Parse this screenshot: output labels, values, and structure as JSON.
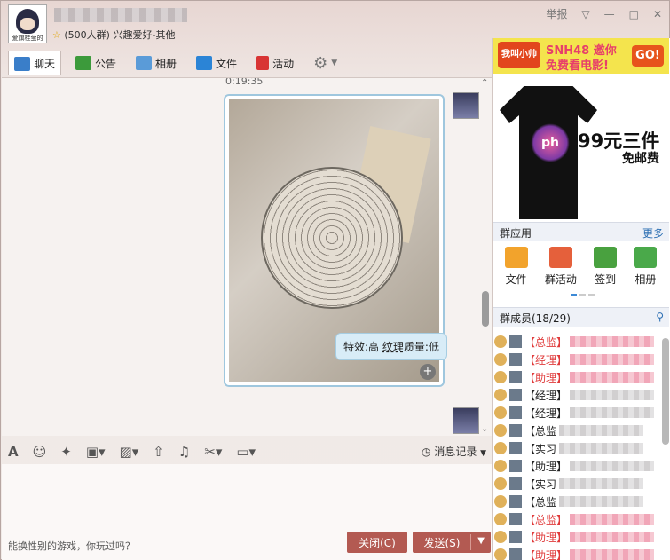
{
  "window": {
    "group_name": "",
    "subtitle_count": "(500人群)",
    "subtitle_category": "兴趣爱好-其他",
    "avatar_caption": "爱旗桂萤的",
    "report_label": "举报",
    "controls": [
      "▽",
      "—",
      "□",
      "✕"
    ]
  },
  "tabs": [
    {
      "label": "聊天",
      "icon": "chat-icon",
      "color": "#3a7ec9"
    },
    {
      "label": "公告",
      "icon": "announcement-flag-icon",
      "color": "#3c9a3b"
    },
    {
      "label": "相册",
      "icon": "photo-album-icon",
      "color": "#5a9bd8"
    },
    {
      "label": "文件",
      "icon": "folder-icon",
      "color": "#2b84d6"
    },
    {
      "label": "活动",
      "icon": "red-flag-icon",
      "color": "#d83434"
    }
  ],
  "chat": {
    "timestamp": "0:19:35",
    "effect_prefix": "特效:高 ",
    "effect_texture": "纹理",
    "effect_suffix": "质量:低"
  },
  "input_toolbar": {
    "history_label": "消息记录",
    "tools": [
      "font-icon",
      "emoji-icon",
      "magic-icon",
      "gift-icon",
      "image-icon",
      "upload-icon",
      "music-icon",
      "scissors-icon",
      "video-icon"
    ]
  },
  "footer": {
    "game_hint": "能换性别的游戏，你玩过吗？",
    "close_label": "关闭(C)",
    "send_label": "发送(S)"
  },
  "ads": {
    "top_brand": "我叫小帅",
    "top_line1": "SNH48 邀你",
    "top_line2": "免费看电影!",
    "top_go": "GO!",
    "shirt_print": "ph",
    "shirt_price": "99元三件",
    "shirt_shipping": "免邮费"
  },
  "group_apps": {
    "title": "群应用",
    "more": "更多",
    "items": [
      {
        "label": "文件",
        "color": "#f2a32c"
      },
      {
        "label": "群活动",
        "color": "#e5603b"
      },
      {
        "label": "签到",
        "color": "#49a13f"
      },
      {
        "label": "相册",
        "color": "#4aa94a"
      }
    ]
  },
  "members": {
    "title": "群成员(18/29)",
    "list": [
      {
        "role": "【总监】",
        "red": true
      },
      {
        "role": "【经理】",
        "red": true
      },
      {
        "role": "【助理】",
        "red": true
      },
      {
        "role": "【经理】",
        "red": false
      },
      {
        "role": "【经理】",
        "red": false
      },
      {
        "role": "【总监",
        "red": false
      },
      {
        "role": "【实习",
        "red": false
      },
      {
        "role": "【助理】",
        "red": false
      },
      {
        "role": "【实习",
        "red": false
      },
      {
        "role": "【总监",
        "red": false
      },
      {
        "role": "【总监】",
        "red": true
      },
      {
        "role": "【助理】",
        "red": true
      },
      {
        "role": "【助理】",
        "red": true
      }
    ]
  },
  "colors": {
    "accent": "#b35a52",
    "bubble": "#d8ecf7",
    "link": "#2c6fb3"
  }
}
